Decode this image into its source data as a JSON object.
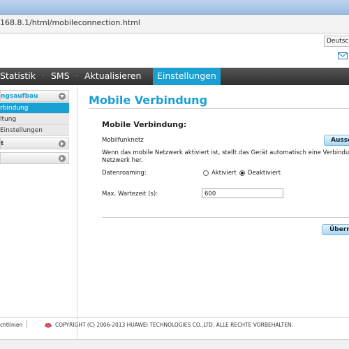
{
  "browser": {
    "address": "168.8.1/html/mobileconnection.html"
  },
  "header": {
    "language": "Deutsch",
    "mail_icon": "envelope-icon"
  },
  "nav": {
    "items": [
      {
        "label": "Statistik"
      },
      {
        "label": "SMS"
      },
      {
        "label": "Aktualisieren"
      },
      {
        "label": "Einstellungen",
        "active": true
      }
    ],
    "separator": "·",
    "active_color": "#1a9fd3"
  },
  "sidebar": {
    "groups": [
      {
        "label": "ngsaufbau",
        "icon": "chevron-down-icon",
        "active": true,
        "items": [
          {
            "label": "rbindung",
            "active": true
          },
          {
            "label": "ltung"
          },
          {
            "label": "Einstellungen"
          }
        ]
      },
      {
        "label": "t",
        "icon": "chevron-right-icon"
      },
      {
        "label": "",
        "icon": "chevron-right-icon"
      }
    ]
  },
  "main": {
    "title": "Mobile Verbindung",
    "section_title": "Mobile Verbindung:",
    "mobilfunknetz_label": "Mobilfunknetz",
    "mobilfunknetz_button": "Aussc",
    "info_line1": "Wenn das mobile Netzwerk aktiviert ist, stellt das Gerät automatisch eine Verbindung",
    "info_line2": "Netzwerk her.",
    "roaming_label": "Datenroaming:",
    "roaming_options": [
      {
        "label": "Aktiviert",
        "checked": false
      },
      {
        "label": "Deaktiviert",
        "checked": true
      }
    ],
    "wait_label": "Max. Wartezeit (s):",
    "wait_value": "600",
    "apply_button": "Überne"
  },
  "footer": {
    "left": "chtlinien",
    "copyright": "COPYRIGHT (C) 2006-2013 HUAWEI TECHNOLOGIES CO.,LTD. ALLE RECHTE VORBEHALTEN.",
    "logo_icon": "huawei-logo-icon",
    "brand_color": "#c8102e"
  }
}
